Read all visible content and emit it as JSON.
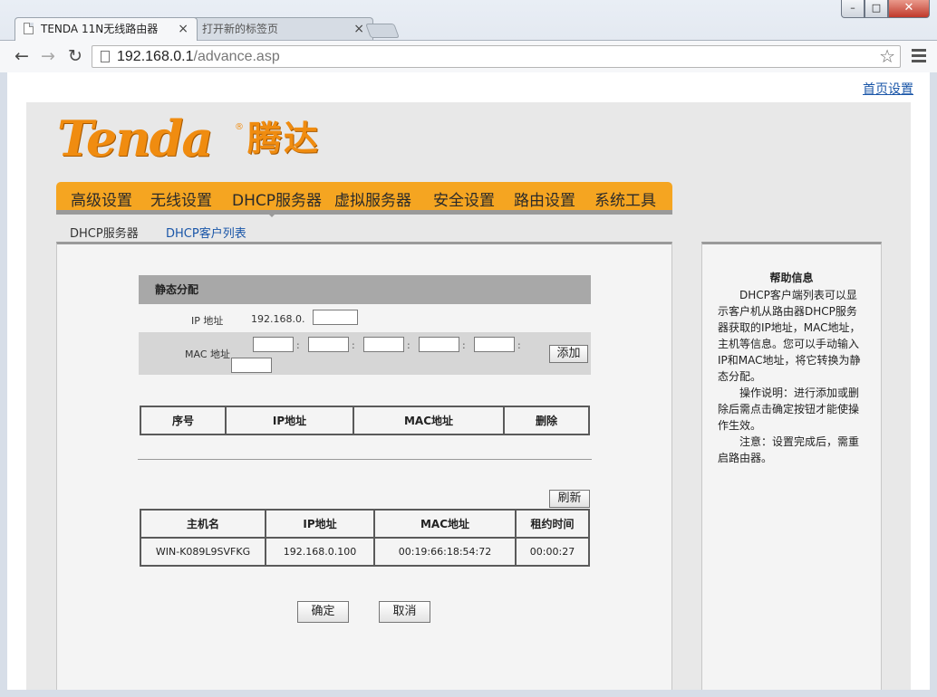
{
  "browser": {
    "tabs": [
      {
        "title": "TENDA 11N无线路由器",
        "close": "×"
      },
      {
        "title": "打开新的标签页",
        "close": "×"
      }
    ],
    "url_host": "192.168.0.1",
    "url_path": "/advance.asp",
    "window_buttons": {
      "minimize": "–",
      "maximize": "□",
      "close": "✕"
    }
  },
  "top_link": "首页设置",
  "logo": {
    "word": "Tenda",
    "reg": "®",
    "cn": "腾达"
  },
  "nav": {
    "items": [
      "高级设置",
      "无线设置",
      "DHCP服务器",
      "虚拟服务器",
      "安全设置",
      "路由设置",
      "系统工具"
    ],
    "active_index": 2
  },
  "subnav": {
    "items": [
      "DHCP服务器",
      "DHCP客户列表"
    ],
    "active_index": 1
  },
  "static_alloc": {
    "title": "静态分配",
    "ip_label": "IP 地址",
    "ip_prefix": "192.168.0.",
    "ip_value": "",
    "mac_label": "MAC 地址",
    "mac_separator": ":",
    "add_button": "添加"
  },
  "static_table": {
    "headers": [
      "序号",
      "IP地址",
      "MAC地址",
      "删除"
    ],
    "rows": []
  },
  "refresh_button": "刷新",
  "client_table": {
    "headers": [
      "主机名",
      "IP地址",
      "MAC地址",
      "租约时间"
    ],
    "rows": [
      [
        "WIN-K089L9SVFKG",
        "192.168.0.100",
        "00:19:66:18:54:72",
        "00:00:27"
      ]
    ]
  },
  "buttons": {
    "ok": "确定",
    "cancel": "取消"
  },
  "help": {
    "title": "帮助信息",
    "p1": "DHCP客户端列表可以显示客户机从路由器DHCP服务器获取的IP地址，MAC地址，主机等信息。您可以手动输入IP和MAC地址，将它转换为静态分配。",
    "p2": "操作说明：进行添加或删除后需点击确定按钮才能使操作生效。",
    "p3": "注意：设置完成后，需重启路由器。"
  },
  "colors": {
    "accent_orange": "#f5a521",
    "logo_orange": "#f08c10",
    "link_blue": "#1a56a8"
  }
}
